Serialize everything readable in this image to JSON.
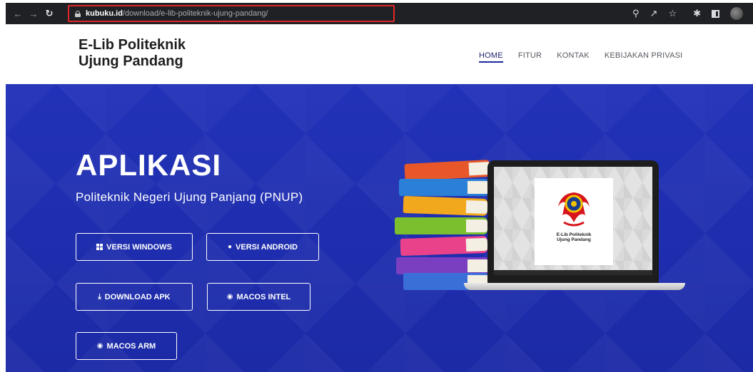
{
  "browser": {
    "url_host": "kubuku.id",
    "url_path": "/download/e-lib-politeknik-ujung-pandang/"
  },
  "site": {
    "logo_line1": "E-Lib Politeknik",
    "logo_line2": "Ujung Pandang",
    "menu": [
      {
        "label": "HOME",
        "active": true
      },
      {
        "label": "FITUR",
        "active": false
      },
      {
        "label": "KONTAK",
        "active": false
      },
      {
        "label": "KEBIJAKAN PRIVASI",
        "active": false
      }
    ]
  },
  "hero": {
    "title": "APLIKASI",
    "subtitle": "Politeknik Negeri Ujung Panjang (PNUP)",
    "buttons": [
      {
        "label": "VERSI WINDOWS",
        "icon": "windows-icon"
      },
      {
        "label": "VERSI ANDROID",
        "icon": "android-icon"
      },
      {
        "label": "DOWNLOAD APK",
        "icon": "download-icon"
      },
      {
        "label": "MACOS INTEL",
        "icon": "apple-icon"
      },
      {
        "label": "MACOS ARM",
        "icon": "apple-icon"
      }
    ],
    "app_card_text_1": "E-Lib Politeknik",
    "app_card_text_2": "Ujung Pandang"
  },
  "colors": {
    "hero_bg": "#1f2fb0",
    "url_highlight": "#e0262a",
    "chrome_bg": "#202124"
  }
}
